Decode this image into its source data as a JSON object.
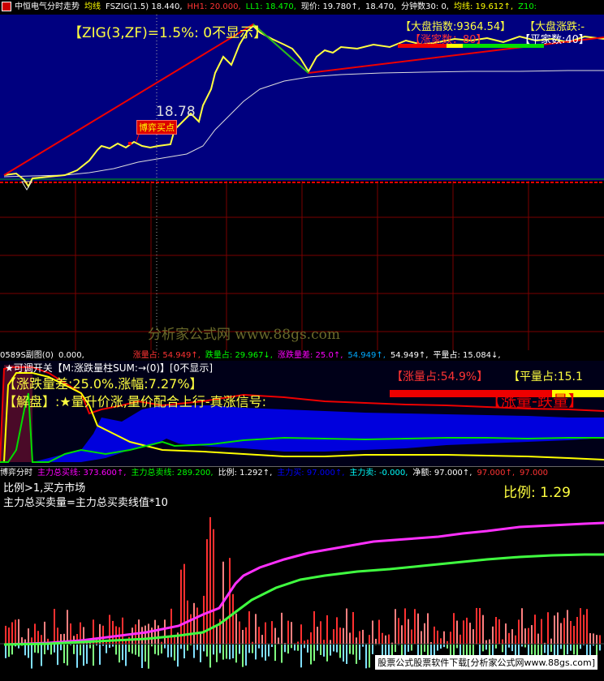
{
  "colors": {
    "navy": "#00007f",
    "blue": "#0000dd",
    "red": "#e00000",
    "yellow": "#ffff40",
    "green": "#00ee00",
    "magenta": "#ff30ff",
    "grid": "#7a0000",
    "lime": "#40ff40"
  },
  "top_header": {
    "title": "中恒电气分时走势",
    "avg": "均线",
    "fszig": "FSZIG(1.5) 18.440,",
    "hh1": "HH1: 20.000,",
    "ll1": "LL1: 18.470,",
    "price": "现价: 19.780↑,",
    "v2": "18.470,",
    "minutes": "分钟数30: 0,",
    "avgline": "均线: 19.612↑,",
    "z": "Z10:"
  },
  "main_panel": {
    "zig_label": "【ZIG(3,ZF)=1.5%:  0不显示】",
    "price_label": "18.78",
    "boxed_label": "博弈买点",
    "index_label": "【大盘指数:9364.54】",
    "index_fall": "【大盘涨跌:-",
    "up_count": "【涨家数：80】",
    "flat_count": "【平家数:40】"
  },
  "watermark": "分析家公式网  www.88gs.com",
  "sub1_header": {
    "name": "0589S副图(0)",
    "val": "0.000,",
    "up_ratio": "涨量占: 54.949↑,",
    "down_ratio": "跌量占: 29.967↓,",
    "diff": "涨跌量差: 25.0↑,",
    "v1": "54.949↑,",
    "v2": "54.949↑,",
    "flat_ratio": "平量占: 15.084↓,"
  },
  "sub1_panel": {
    "switch_label": "★可调开关【M:涨跌量柱SUM:→(0)】[0不显示]",
    "diff_label": "【涨跌量差:25.0%.涨幅:7.27%】",
    "explain_label": "【解盘】:★量升价涨,量价配合上行-真涨信号:",
    "up_ratio_label": "【涨量占:54.9%】",
    "flat_ratio_label": "【平量占:15.1",
    "big_label": "【涨量-跌量】"
  },
  "sub2_header": {
    "name": "博弈分时",
    "buy": "主力总买线: 373.600↑,",
    "sell": "主力总卖线: 289.200,",
    "ratio": "比例: 1.292↑,",
    "mbuy": "主力买: 97.000↑,",
    "msell": "主力卖: -0.000,",
    "net": "净额: 97.000↑,",
    "v": "97.000↑,",
    "v2": "97.000"
  },
  "sub2_panel": {
    "line1": "比例>1,买方市场",
    "line2": "主力总买卖量=主力总买卖线值*10",
    "ratio_label": "比例: 1.29"
  },
  "footer": "股票公式股票软件下载[分析家公式网www.88gs.com]"
}
